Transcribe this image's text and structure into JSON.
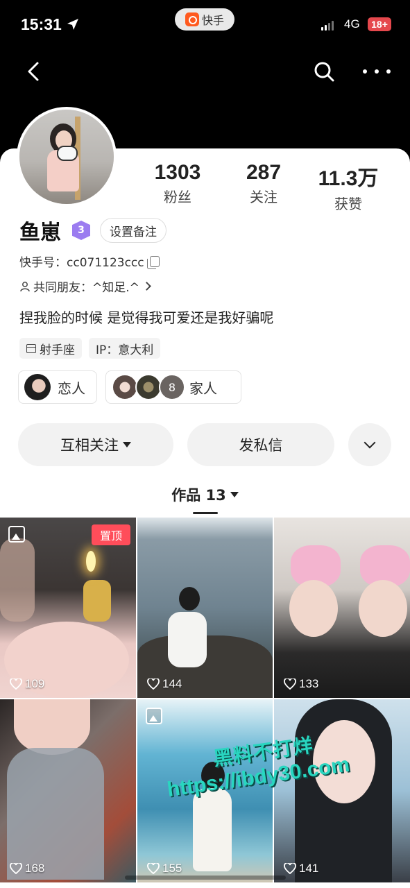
{
  "status_bar": {
    "time": "15:31",
    "app_name": "快手",
    "network": "4G",
    "battery": "18+"
  },
  "profile": {
    "name": "鱼崽",
    "level": "3",
    "remark_button": "设置备注",
    "kwai_id": "快手号：cc071123ccc",
    "mutual_friends": "共同朋友：^知足.^",
    "bio": "捏我脸的时候 是觉得我可爱还是我好骗呢",
    "tags": [
      "射手座",
      "IP：意大利"
    ]
  },
  "stats": [
    {
      "value": "1303",
      "label": "粉丝"
    },
    {
      "value": "287",
      "label": "关注"
    },
    {
      "value": "11.3万",
      "label": "获赞"
    }
  ],
  "relations": [
    {
      "label": "恋人"
    },
    {
      "label": "家人",
      "count": "8"
    }
  ],
  "actions": {
    "follow": "互相关注",
    "message": "发私信"
  },
  "works": {
    "tab_label": "作品 13"
  },
  "posts": [
    {
      "likes": "109",
      "pinned": "置顶"
    },
    {
      "likes": "144"
    },
    {
      "likes": "133"
    },
    {
      "likes": "168"
    },
    {
      "likes": "155"
    },
    {
      "likes": "141"
    }
  ],
  "watermark": {
    "line1": "黑料不打烊",
    "line2": "https://ibdy30.com"
  }
}
